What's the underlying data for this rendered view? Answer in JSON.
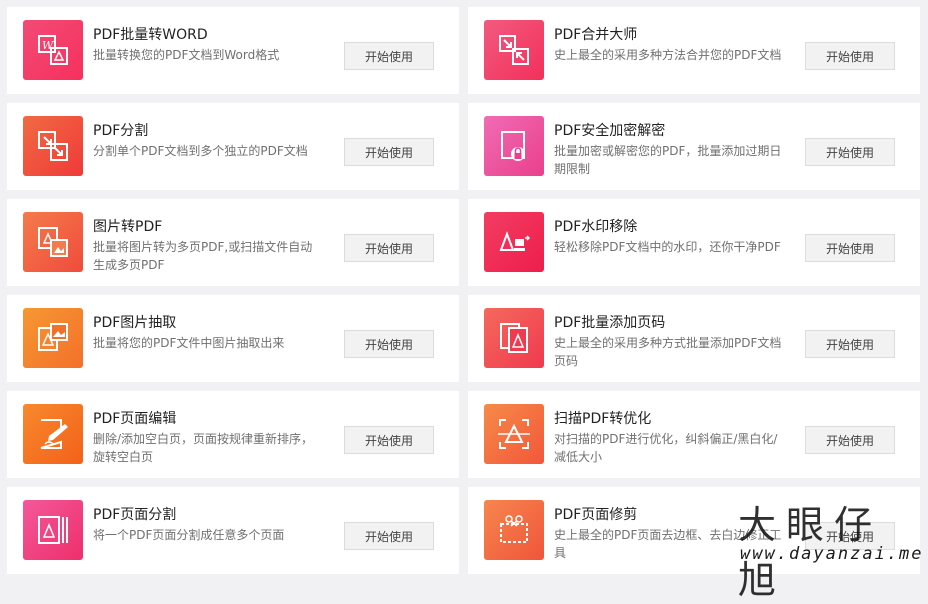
{
  "button_label": "开始使用",
  "cards": [
    {
      "title": "PDF批量转WORD",
      "desc": "批量转换您的PDF文档到Word格式",
      "icon": "pdf-to-word-icon",
      "color": "#f6436b"
    },
    {
      "title": "PDF合并大师",
      "desc": "史上最全的采用多种方法合并您的PDF文档",
      "icon": "merge-icon",
      "color": "#f6436b"
    },
    {
      "title": "PDF分割",
      "desc": "分割单个PDF文档到多个独立的PDF文档",
      "icon": "split-icon",
      "color": "#f2553d"
    },
    {
      "title": "PDF安全加密解密",
      "desc": "批量加密或解密您的PDF，批量添加过期日期限制",
      "icon": "lock-icon",
      "color": "#ef49a3"
    },
    {
      "title": "图片转PDF",
      "desc": "批量将图片转为多页PDF,或扫描文件自动生成多页PDF",
      "icon": "image-to-pdf-icon",
      "color": "#f56242"
    },
    {
      "title": "PDF水印移除",
      "desc": "轻松移除PDF文档中的水印，还你干净PDF",
      "icon": "watermark-remove-icon",
      "color": "#f2305a"
    },
    {
      "title": "PDF图片抽取",
      "desc": "批量将您的PDF文件中图片抽取出来",
      "icon": "image-extract-icon",
      "color": "#f67b2d"
    },
    {
      "title": "PDF批量添加页码",
      "desc": "史上最全的采用多种方式批量添加PDF文档页码",
      "icon": "page-number-icon",
      "color": "#f34e5c"
    },
    {
      "title": "PDF页面编辑",
      "desc": "删除/添加空白页，页面按规律重新排序，旋转空白页",
      "icon": "page-edit-icon",
      "color": "#f77a1e"
    },
    {
      "title": "扫描PDF转优化",
      "desc": "对扫描的PDF进行优化，纠斜偏正/黑白化/减低大小",
      "icon": "scan-optimize-icon",
      "color": "#f56d3c"
    },
    {
      "title": "PDF页面分割",
      "desc": "将一个PDF页面分割成任意多个页面",
      "icon": "page-split-icon",
      "color": "#f2407d"
    },
    {
      "title": "PDF页面修剪",
      "desc": "史上最全的PDF页面去边框、去白边修正工具",
      "icon": "page-crop-icon",
      "color": "#f56a3a"
    }
  ],
  "watermark": {
    "cn": "大眼仔旭",
    "url": "www.dayanzai.me"
  }
}
